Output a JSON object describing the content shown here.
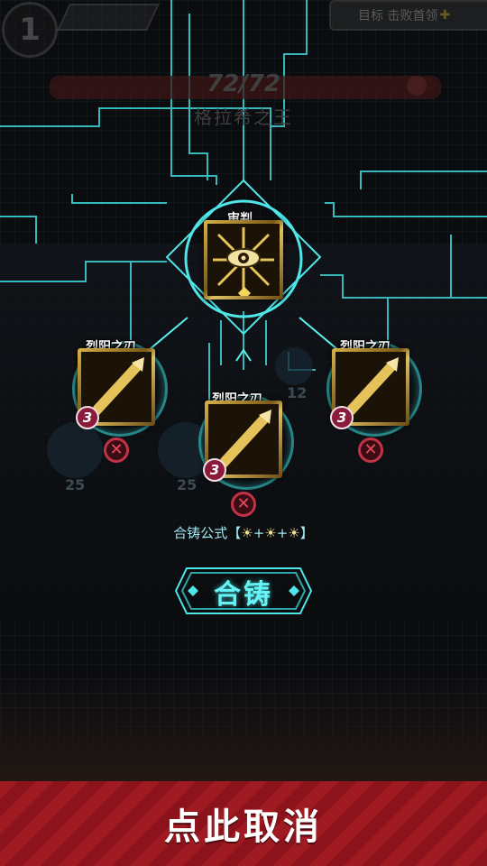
{
  "hud": {
    "level": "1",
    "goal_text": "目标 击败首领",
    "goal_plus": "✚",
    "hp_text": "72/72",
    "hp_fraction": 1.0,
    "boss_name": "格拉希之王"
  },
  "enemies": [
    {
      "hp": "25"
    },
    {
      "hp": "25"
    },
    {
      "hp": "12"
    }
  ],
  "result_card": {
    "title": "审判",
    "icon": "eye-sun-icon"
  },
  "ingredients": [
    {
      "title": "烈阳之刃",
      "count": "3",
      "icon": "golden-blade-icon"
    },
    {
      "title": "烈阳之刃",
      "count": "3",
      "icon": "golden-blade-icon"
    },
    {
      "title": "烈阳之刃",
      "count": "3",
      "icon": "golden-blade-icon"
    }
  ],
  "formula": {
    "prefix": "合铸公式【",
    "suffix": "】",
    "items": [
      "☀",
      "☀",
      "☀"
    ],
    "plus": "+"
  },
  "fuse_button": {
    "label": "合铸"
  },
  "cancel_bar": {
    "label": "点此取消"
  },
  "colors": {
    "accent_cyan": "#4fe6e8",
    "card_gold": "#d9b248",
    "cancel_red": "#a01a22",
    "remove_red": "#c23247"
  }
}
